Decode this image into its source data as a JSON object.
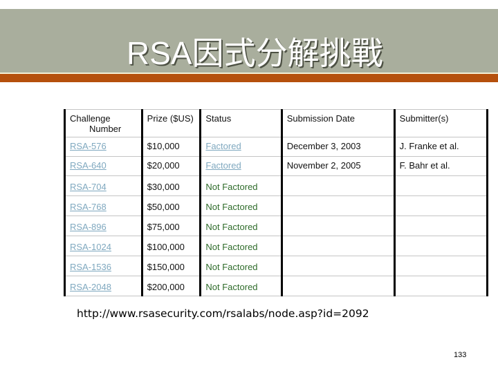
{
  "slide": {
    "title": "RSA因式分解挑戰",
    "colors": {
      "title_band": "#a9ae9d",
      "accent_band": "#b5500d",
      "link": "#7fa8bf",
      "not_factored": "#2e6b2a"
    },
    "page_number": "133",
    "source_url": "http://www.rsasecurity.com/rsalabs/node.asp?id=2092"
  },
  "table": {
    "headers": {
      "challenge_line1": "Challenge",
      "challenge_line2": "Number",
      "prize": "Prize ($US)",
      "status": "Status",
      "date": "Submission Date",
      "submitter": "Submitter(s)"
    },
    "rows": [
      {
        "challenge": "RSA-576",
        "prize": "$10,000",
        "status": "Factored",
        "status_is_link": true,
        "date": "December 3, 2003",
        "submitter": "J. Franke et al."
      },
      {
        "challenge": "RSA-640",
        "prize": "$20,000",
        "status": "Factored",
        "status_is_link": true,
        "date": "November 2, 2005",
        "submitter": "F. Bahr et al."
      },
      {
        "challenge": "RSA-704",
        "prize": "$30,000",
        "status": "Not Factored",
        "status_is_link": false,
        "date": "",
        "submitter": ""
      },
      {
        "challenge": "RSA-768",
        "prize": "$50,000",
        "status": "Not Factored",
        "status_is_link": false,
        "date": "",
        "submitter": ""
      },
      {
        "challenge": "RSA-896",
        "prize": "$75,000",
        "status": "Not Factored",
        "status_is_link": false,
        "date": "",
        "submitter": ""
      },
      {
        "challenge": "RSA-1024",
        "prize": "$100,000",
        "status": "Not Factored",
        "status_is_link": false,
        "date": "",
        "submitter": ""
      },
      {
        "challenge": "RSA-1536",
        "prize": "$150,000",
        "status": "Not Factored",
        "status_is_link": false,
        "date": "",
        "submitter": ""
      },
      {
        "challenge": "RSA-2048",
        "prize": "$200,000",
        "status": "Not Factored",
        "status_is_link": false,
        "date": "",
        "submitter": ""
      }
    ]
  }
}
